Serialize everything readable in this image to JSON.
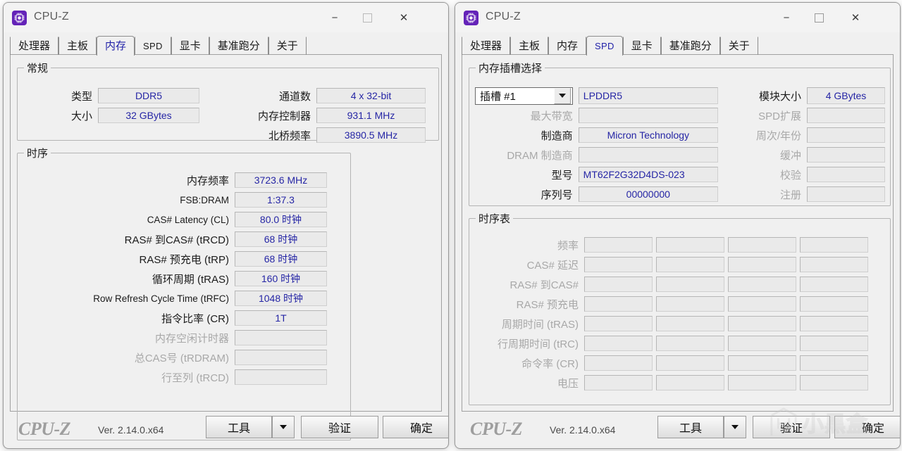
{
  "window_left": {
    "title": "CPU-Z",
    "icon": "cpu-chip-icon",
    "controls": {
      "minimize": "−",
      "maximize": "☐",
      "close": "✕"
    },
    "tabs": [
      {
        "label": "处理器",
        "active": false
      },
      {
        "label": "主板",
        "active": false
      },
      {
        "label": "内存",
        "active": true
      },
      {
        "label": "SPD",
        "active": false
      },
      {
        "label": "显卡",
        "active": false
      },
      {
        "label": "基准跑分",
        "active": false
      },
      {
        "label": "关于",
        "active": false
      }
    ],
    "general": {
      "legend": "常规",
      "left_rows": [
        {
          "label": "类型",
          "value": "DDR5",
          "dim": false
        },
        {
          "label": "大小",
          "value": "32 GBytes",
          "dim": false
        }
      ],
      "right_rows": [
        {
          "label": "通道数",
          "value": "4 x 32-bit",
          "dim": false
        },
        {
          "label": "内存控制器",
          "value": "931.1 MHz",
          "dim": false
        },
        {
          "label": "北桥频率",
          "value": "3890.5 MHz",
          "dim": false
        }
      ]
    },
    "timings": {
      "legend": "时序",
      "rows": [
        {
          "label": "内存频率",
          "value": "3723.6 MHz",
          "dim": false,
          "latin": false
        },
        {
          "label": "FSB:DRAM",
          "value": "1:37.3",
          "dim": false,
          "latin": true
        },
        {
          "label": "CAS# Latency (CL)",
          "value": "80.0 时钟",
          "dim": false,
          "latin": true
        },
        {
          "label": "RAS# 到CAS# (tRCD)",
          "value": "68 时钟",
          "dim": false,
          "latin": false
        },
        {
          "label": "RAS# 预充电 (tRP)",
          "value": "68 时钟",
          "dim": false,
          "latin": false
        },
        {
          "label": "循环周期 (tRAS)",
          "value": "160 时钟",
          "dim": false,
          "latin": false
        },
        {
          "label": "Row Refresh Cycle Time (tRFC)",
          "value": "1048 时钟",
          "dim": false,
          "latin": true
        },
        {
          "label": "指令比率 (CR)",
          "value": "1T",
          "dim": false,
          "latin": false
        },
        {
          "label": "内存空闲计时器",
          "value": "",
          "dim": true,
          "latin": false
        },
        {
          "label": "总CAS号 (tRDRAM)",
          "value": "",
          "dim": true,
          "latin": false
        },
        {
          "label": "行至列 (tRCD)",
          "value": "",
          "dim": true,
          "latin": false
        }
      ]
    },
    "footer": {
      "brand": "CPU-Z",
      "version": "Ver. 2.14.0.x64",
      "tools_label": "工具",
      "tools_dropdown": "▼",
      "validate_label": "验证",
      "ok_label": "确定"
    }
  },
  "window_right": {
    "title": "CPU-Z",
    "icon": "cpu-chip-icon",
    "controls": {
      "minimize": "−",
      "maximize": "☐",
      "close": "✕"
    },
    "tabs": [
      {
        "label": "处理器",
        "active": false
      },
      {
        "label": "主板",
        "active": false
      },
      {
        "label": "内存",
        "active": false
      },
      {
        "label": "SPD",
        "active": true
      },
      {
        "label": "显卡",
        "active": false
      },
      {
        "label": "基准跑分",
        "active": false
      },
      {
        "label": "关于",
        "active": false
      }
    ],
    "slot_select": {
      "legend": "内存插槽选择",
      "slot_value": "插槽 #1",
      "slot_options": [
        "插槽 #1"
      ],
      "module_type": "LPDDR5",
      "left_rows": [
        {
          "label": "最大带宽",
          "value": "",
          "dim": true,
          "align": "center"
        },
        {
          "label": "制造商",
          "value": "Micron Technology",
          "dim": false,
          "align": "center"
        },
        {
          "label": "DRAM 制造商",
          "value": "",
          "dim": true,
          "align": "center"
        },
        {
          "label": "型号",
          "value": "MT62F2G32D4DS-023",
          "dim": false,
          "align": "left"
        },
        {
          "label": "序列号",
          "value": "00000000",
          "dim": false,
          "align": "center"
        }
      ],
      "right_rows": [
        {
          "label": "模块大小",
          "value": "4 GBytes",
          "dim": false
        },
        {
          "label": "SPD扩展",
          "value": "",
          "dim": true
        },
        {
          "label": "周次/年份",
          "value": "",
          "dim": true
        },
        {
          "label": "缓冲",
          "value": "",
          "dim": true
        },
        {
          "label": "校验",
          "value": "",
          "dim": true
        },
        {
          "label": "注册",
          "value": "",
          "dim": true
        }
      ]
    },
    "timing_table": {
      "legend": "时序表",
      "columns": 4,
      "rows": [
        {
          "label": "频率",
          "values": [
            "",
            "",
            "",
            ""
          ],
          "dim": true
        },
        {
          "label": "CAS# 延迟",
          "values": [
            "",
            "",
            "",
            ""
          ],
          "dim": true
        },
        {
          "label": "RAS# 到CAS#",
          "values": [
            "",
            "",
            "",
            ""
          ],
          "dim": true
        },
        {
          "label": "RAS# 预充电",
          "values": [
            "",
            "",
            "",
            ""
          ],
          "dim": true
        },
        {
          "label": "周期时间 (tRAS)",
          "values": [
            "",
            "",
            "",
            ""
          ],
          "dim": true
        },
        {
          "label": "行周期时间 (tRC)",
          "values": [
            "",
            "",
            "",
            ""
          ],
          "dim": true
        },
        {
          "label": "命令率 (CR)",
          "values": [
            "",
            "",
            "",
            ""
          ],
          "dim": true
        },
        {
          "label": "电压",
          "values": [
            "",
            "",
            "",
            ""
          ],
          "dim": true
        }
      ]
    },
    "footer": {
      "brand": "CPU-Z",
      "version": "Ver. 2.14.0.x64",
      "tools_label": "工具",
      "tools_dropdown": "▼",
      "validate_label": "验证",
      "ok_label": "确定"
    },
    "watermark": {
      "text": "小黑盒",
      "logo": "xiaoheihe-logo-icon"
    }
  },
  "colors": {
    "accent_value_text": "#2525a5",
    "tab_active_text": "#2222a8",
    "window_bg": "#f0f0f0",
    "field_bg": "#eaeaea",
    "disabled_text": "#a8a8a8",
    "app_icon_bg": "#6423b8"
  }
}
